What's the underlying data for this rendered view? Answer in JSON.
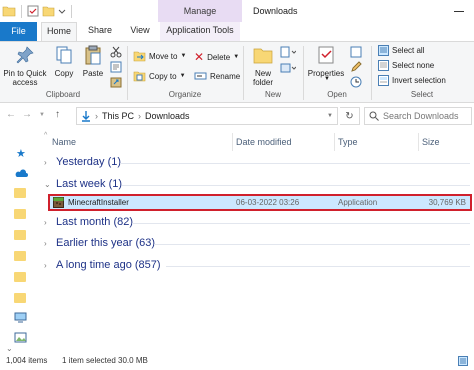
{
  "window": {
    "manage_label": "Manage",
    "title": "Downloads"
  },
  "ribbon_tabs": {
    "file": "File",
    "home": "Home",
    "share": "Share",
    "view": "View",
    "application_tools": "Application Tools"
  },
  "ribbon": {
    "clipboard": {
      "pin": "Pin to Quick",
      "pin2": "access",
      "copy": "Copy",
      "paste": "Paste",
      "label": "Clipboard"
    },
    "organize": {
      "move_to": "Move to",
      "copy_to": "Copy to",
      "delete": "Delete",
      "rename": "Rename",
      "label": "Organize"
    },
    "new": {
      "new_folder": "New",
      "new_folder2": "folder",
      "label": "New"
    },
    "open": {
      "properties": "Properties",
      "label": "Open"
    },
    "select": {
      "select_all": "Select all",
      "select_none": "Select none",
      "invert": "Invert selection",
      "label": "Select"
    }
  },
  "address": {
    "this_pc": "This PC",
    "downloads": "Downloads",
    "search_placeholder": "Search Downloads"
  },
  "columns": {
    "name": "Name",
    "date_modified": "Date modified",
    "type": "Type",
    "size": "Size"
  },
  "groups": {
    "yesterday": "Yesterday (1)",
    "last_week": "Last week (1)",
    "last_month": "Last month (82)",
    "earlier_this_year": "Earlier this year (63)",
    "long_time_ago": "A long time ago (857)"
  },
  "selected_file": {
    "name": "MinecraftInstaller",
    "date": "06-03-2022 03:26",
    "type": "Application",
    "size": "30,769 KB"
  },
  "status": {
    "items": "1,004 items",
    "selected": "1 item selected  30.0 MB"
  },
  "colors": {
    "accent": "#1979ca",
    "selection": "#cce8ff",
    "highlight_border": "#d0202c",
    "manage_tab": "#e8dcf3",
    "group_text": "#1e3287"
  }
}
